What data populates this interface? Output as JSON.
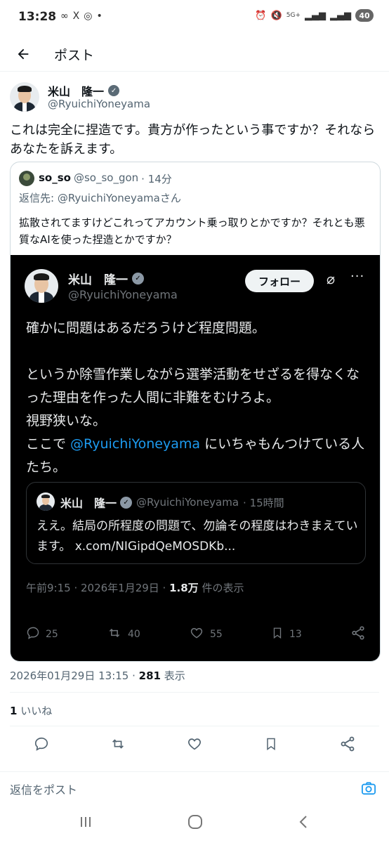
{
  "status_bar": {
    "time": "13:28",
    "left_icons": [
      "∞",
      "X",
      "◎",
      "•"
    ],
    "network": "5G+",
    "battery": "40"
  },
  "appbar": {
    "title": "ポスト"
  },
  "post": {
    "author_name": "米山　隆一",
    "author_handle": "@RyuichiYoneyama",
    "text": "これは完全に捏造です。貴方が作ったという事ですか？それならあなたを訴えます。"
  },
  "quote": {
    "user": "so_so",
    "handle": "@so_so_gon",
    "time": "· 14分",
    "reply_to": "返信先: @RyuichiYoneyamaさん",
    "text": "拡散されてますけどこれってアカウント乗っ取りとかですか？それとも悪質なAIを使った捏造とかですか？"
  },
  "screenshot": {
    "author_name": "米山　隆一",
    "author_handle": "@RyuichiYoneyama",
    "follow_label": "フォロー",
    "text_1": "確かに問題はあるだろうけど程度問題。\n\nというか除雪作業しながら選挙活動をせざるを得なくなった理由を作った人間に非難をむけろよ。\n視野狭いな。\nここで ",
    "mention": "@RyuichiYoneyama",
    "text_2": " にいちゃもんつけている人たち。",
    "inner_quote": {
      "author_name": "米山　隆一",
      "handle": "@RyuichiYoneyama",
      "time": "· 15時間",
      "text": "ええ。結局の所程度の問題で、勿論その程度はわきまえています。 x.com/NIGipdQeMOSDKb..."
    },
    "timestamp": "午前9:15 · 2026年1月29日 · ",
    "views_count": "1.8万",
    "views_label": " 件の表示",
    "replies": "25",
    "reposts": "40",
    "likes": "55",
    "bookmarks": "13"
  },
  "post_meta": {
    "timestamp": "2026年01月29日 13:15 · ",
    "views_count": "281",
    "views_label": " 表示"
  },
  "likes_row": {
    "count": "1",
    "label": " いいね"
  },
  "reply_bar": {
    "placeholder": "返信をポスト"
  },
  "icons": {
    "back": "back-arrow-icon",
    "reply": "reply-icon",
    "repost": "repost-icon",
    "like": "heart-icon",
    "bookmark": "bookmark-icon",
    "share": "share-icon",
    "camera": "camera-icon"
  }
}
